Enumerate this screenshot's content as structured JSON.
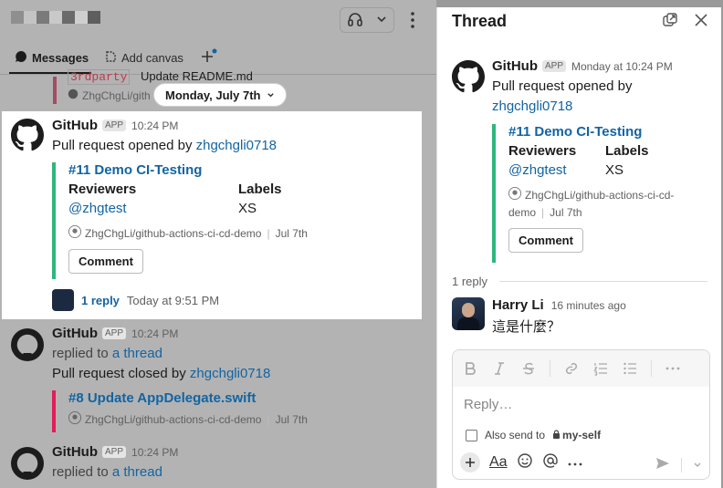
{
  "channel": {
    "tabs": {
      "messages": "Messages",
      "add_canvas": "Add canvas"
    },
    "date_pill": "Monday, July 7th",
    "partial_top": {
      "label": "3rdparty",
      "text": "Update README.md",
      "repo": "ZhgChgLi/gith"
    },
    "msg1": {
      "name": "GitHub",
      "badge": "APP",
      "time": "10:24 PM",
      "text": "Pull request opened by ",
      "user": "zhgchgli0718",
      "pr_title": "#11 Demo CI-Testing",
      "f1_label": "Reviewers",
      "f1_value": "@zhgtest",
      "f2_label": "Labels",
      "f2_value": "XS",
      "repo": "ZhgChgLi/github-actions-ci-cd-demo",
      "date": "Jul 7th",
      "button": "Comment",
      "replies": "1 reply",
      "reply_time": "Today at 9:51 PM"
    },
    "msg2": {
      "name": "GitHub",
      "badge": "APP",
      "time": "10:24 PM",
      "replied": "replied to ",
      "thread": "a thread",
      "text": "Pull request closed by ",
      "user": "zhgchgli0718",
      "pr_title": "#8 Update AppDelegate.swift",
      "repo": "ZhgChgLi/github-actions-ci-cd-demo",
      "date": "Jul 7th"
    },
    "msg3": {
      "name": "GitHub",
      "badge": "APP",
      "time": "10:24 PM",
      "replied": "replied to ",
      "thread": "a thread"
    }
  },
  "thread": {
    "title": "Thread",
    "parent": {
      "name": "GitHub",
      "badge": "APP",
      "time": "Monday at 10:24 PM",
      "text": "Pull request opened by",
      "user": "zhgchgli0718",
      "pr_title": "#11 Demo CI-Testing",
      "f1_label": "Reviewers",
      "f1_value": "@zhgtest",
      "f2_label": "Labels",
      "f2_value": "XS",
      "repo": "ZhgChgLi/github-actions-ci-cd-",
      "repo2": "demo",
      "date": "Jul 7th",
      "button": "Comment"
    },
    "reply_count": "1 reply",
    "reply": {
      "name": "Harry Li",
      "time": "16 minutes ago",
      "text": "這是什麼？"
    },
    "composer": {
      "placeholder": "Reply…",
      "also_send": "Also send to",
      "channel": "my-self"
    }
  },
  "colors": {
    "link": "#1264a3",
    "green_bar": "#2eb67d",
    "red_bar": "#e01e5a"
  },
  "icons": [
    "headphones-icon",
    "chevron-down-icon",
    "more-icon",
    "messages-icon",
    "canvas-icon",
    "plus-icon",
    "github-icon",
    "open-window-icon",
    "close-icon",
    "bold-icon",
    "italic-icon",
    "strike-icon",
    "link-icon",
    "ordered-list-icon",
    "bullet-list-icon",
    "lock-icon",
    "emoji-icon",
    "mention-icon",
    "send-icon"
  ]
}
